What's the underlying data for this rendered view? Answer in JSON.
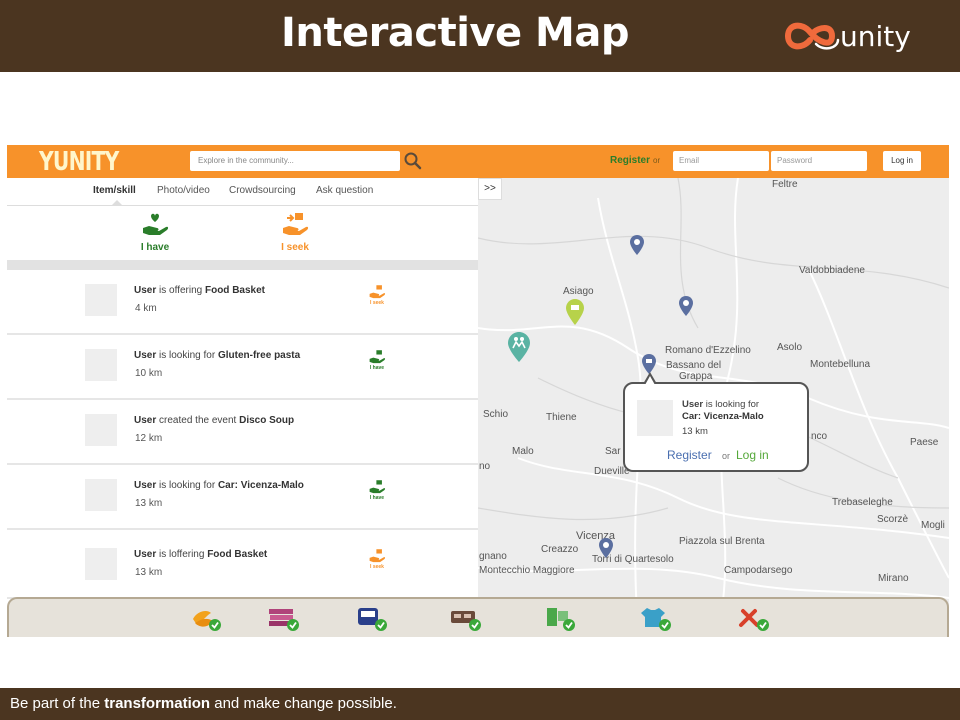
{
  "slide": {
    "title": "Interactive Map",
    "logo_text": "unity",
    "footer_prefix": "Be part of the ",
    "footer_bold": "transformation",
    "footer_suffix": " and make change possible."
  },
  "app": {
    "brand": "YUNITY",
    "search_placeholder": "Explore in the community...",
    "register_label": "Register",
    "or_label": "or",
    "email_placeholder": "Email",
    "password_placeholder": "Password",
    "login_label": "Log in",
    "tabs": [
      "Item/skill",
      "Photo/video",
      "Crowdsourcing",
      "Ask question"
    ],
    "i_have": "I have",
    "i_seek": "I seek",
    "feed": [
      {
        "user": "User",
        "action": " is offering ",
        "object": "Food Basket",
        "distance": "4 km",
        "badge": "I seek",
        "badge_type": "seek"
      },
      {
        "user": "User",
        "action": " is looking for ",
        "object": "Gluten-free pasta",
        "distance": "10 km",
        "badge": "I have",
        "badge_type": "have"
      },
      {
        "user": "User",
        "action": " created the event ",
        "object": "Disco Soup",
        "distance": "12 km",
        "badge": "",
        "badge_type": "none"
      },
      {
        "user": "User",
        "action": " is looking for ",
        "object": "Car: Vicenza-Malo",
        "distance": "13 km",
        "badge": "I have",
        "badge_type": "have"
      },
      {
        "user": "User",
        "action": " is loffering ",
        "object": "Food Basket",
        "distance": "13 km",
        "badge": "I seek",
        "badge_type": "seek"
      }
    ],
    "map": {
      "collapse_label": ">>",
      "towns": [
        "Feltre",
        "Valdobbiadene",
        "Asiago",
        "Romano d'Ezzelino",
        "Asolo",
        "Bassano del",
        "Grappa",
        "Montebelluna",
        "Schio",
        "Thiene",
        "Malo",
        "Dueville",
        "Sar",
        "nco",
        "Paese",
        "Trebaseleghe",
        "Scorzè",
        "Mogli",
        "Vicenza",
        "Creazzo",
        "Torri di Quartesolo",
        "Piazzola sul Brenta",
        "Montecchio Maggiore",
        "gnano",
        "Campodarsego",
        "Mirano",
        "no"
      ],
      "popup": {
        "user": "User",
        "line1_suffix": " is looking for",
        "object": "Car: Vicenza-Malo",
        "distance": "13 km",
        "register": "Register",
        "or": "or",
        "login": "Log in"
      }
    },
    "categories": [
      "food-icon",
      "books-icon",
      "transport-icon",
      "furniture-icon",
      "electronics-icon",
      "clothing-icon",
      "tools-icon"
    ],
    "colors": {
      "orange": "#f7922a",
      "green": "#2a7d2a",
      "brown": "#4b3520",
      "seek": "#f7922a",
      "have": "#2a7d2a"
    }
  }
}
